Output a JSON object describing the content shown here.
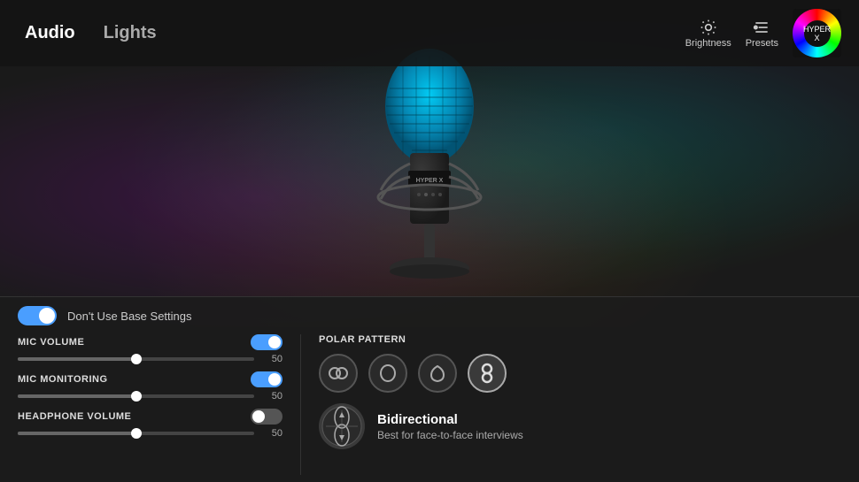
{
  "header": {
    "tab_audio": "Audio",
    "tab_lights": "Lights",
    "brightness_label": "Brightness",
    "presets_label": "Presets"
  },
  "controls": {
    "base_toggle_label": "Don't Use Base Settings",
    "mic_volume_label": "MIC VOLUME",
    "mic_volume_value": "50",
    "mic_volume_pct": 50,
    "mic_monitoring_label": "MIC MONITORING",
    "mic_monitoring_value": "50",
    "mic_monitoring_pct": 50,
    "headphone_volume_label": "HEADPHONE VOLUME",
    "headphone_volume_value": "50",
    "headphone_volume_pct": 50
  },
  "polar": {
    "label": "POLAR PATTERN",
    "active_name": "Bidirectional",
    "active_desc": "Best for face-to-face interviews",
    "patterns": [
      {
        "id": "stereo",
        "label": "Stereo"
      },
      {
        "id": "cardioid",
        "label": "Cardioid"
      },
      {
        "id": "omni",
        "label": "Omnidirectional"
      },
      {
        "id": "bidirectional",
        "label": "Bidirectional"
      }
    ]
  }
}
